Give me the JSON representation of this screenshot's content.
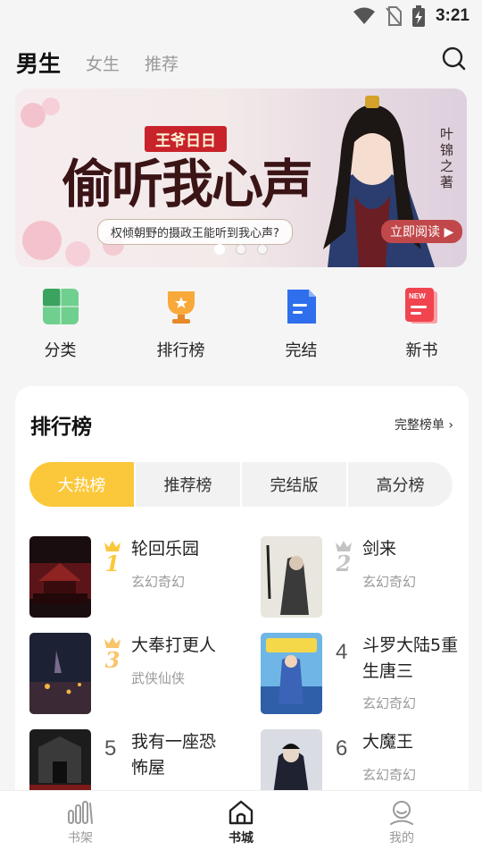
{
  "status_bar": {
    "time": "3:21",
    "icons": [
      "wifi-icon",
      "no-sim-icon",
      "battery-charging-icon"
    ]
  },
  "top_tabs": [
    {
      "label": "男生",
      "active": true
    },
    {
      "label": "女生",
      "active": false
    },
    {
      "label": "推荐",
      "active": false
    }
  ],
  "banner": {
    "badge": "王爷日日",
    "title": "偷听我心声",
    "subtitle": "权倾朝野的摄政王能听到我心声?",
    "author": "叶锦之著",
    "read_button": "立即阅读",
    "dots": 3,
    "active_dot": 0
  },
  "quick_entries": [
    {
      "label": "分类",
      "icon": "category-icon",
      "color": "#4caf6e"
    },
    {
      "label": "排行榜",
      "icon": "trophy-icon",
      "color": "#f5a623"
    },
    {
      "label": "完结",
      "icon": "finished-doc-icon",
      "color": "#2f6fed"
    },
    {
      "label": "新书",
      "icon": "new-book-icon",
      "color": "#f0454f"
    }
  ],
  "ranking": {
    "title": "排行榜",
    "more_link": "完整榜单",
    "tabs": [
      {
        "label": "大热榜",
        "active": true
      },
      {
        "label": "推荐榜",
        "active": false
      },
      {
        "label": "完结版",
        "active": false
      },
      {
        "label": "高分榜",
        "active": false
      }
    ],
    "books": [
      {
        "rank": "1",
        "name": "轮回乐园",
        "genre": "玄幻奇幻",
        "medal": "gold"
      },
      {
        "rank": "2",
        "name": "剑来",
        "genre": "玄幻奇幻",
        "medal": "silver"
      },
      {
        "rank": "3",
        "name": "大奉打更人",
        "genre": "武侠仙侠",
        "medal": "bronze"
      },
      {
        "rank": "4",
        "name": "斗罗大陆5重生唐三",
        "genre": "玄幻奇幻",
        "medal": "none"
      },
      {
        "rank": "5",
        "name": "我有一座恐怖屋",
        "genre": "",
        "medal": "none"
      },
      {
        "rank": "6",
        "name": "大魔王",
        "genre": "玄幻奇幻",
        "medal": "none"
      }
    ]
  },
  "bottom_nav": [
    {
      "label": "书架",
      "icon": "bookshelf-icon",
      "active": false
    },
    {
      "label": "书城",
      "icon": "home-icon",
      "active": true
    },
    {
      "label": "我的",
      "icon": "profile-icon",
      "active": false
    }
  ],
  "colors": {
    "accent": "#fbc73b",
    "gold": "#fbc73b",
    "silver": "#c3c3c3",
    "bronze": "#f9c46b"
  }
}
